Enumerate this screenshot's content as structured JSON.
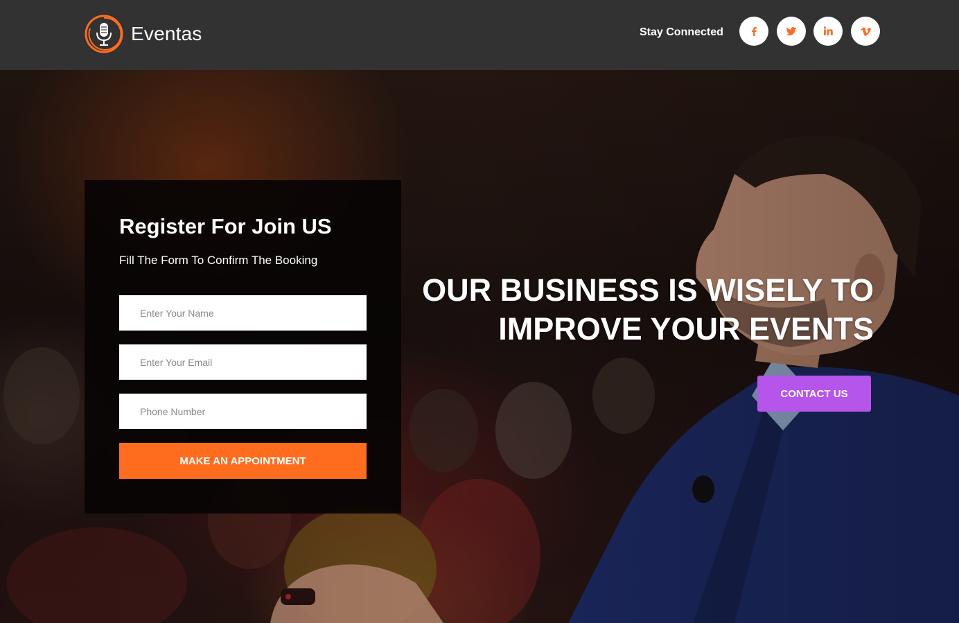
{
  "header": {
    "brand": "Eventas",
    "stay_connected": "Stay Connected",
    "social": [
      {
        "name": "facebook",
        "icon": "facebook-icon"
      },
      {
        "name": "twitter",
        "icon": "twitter-icon"
      },
      {
        "name": "linkedin",
        "icon": "linkedin-icon"
      },
      {
        "name": "vimeo",
        "icon": "vimeo-icon"
      }
    ],
    "logo_icon": "microphone-icon"
  },
  "form": {
    "title": "Register For Join US",
    "subtitle": "Fill The Form To Confirm The Booking",
    "name_placeholder": "Enter Your Name",
    "email_placeholder": "Enter Your Email",
    "phone_placeholder": "Phone Number",
    "submit_label": "MAKE AN APPOINTMENT"
  },
  "hero": {
    "headline_line1": "OUR BUSINESS IS WISELY TO",
    "headline_line2": "IMPROVE YOUR EVENTS",
    "cta_label": "CONTACT US"
  },
  "colors": {
    "accent_orange": "#fe6d1e",
    "accent_purple": "#b555ea",
    "header_bg": "#323232"
  }
}
